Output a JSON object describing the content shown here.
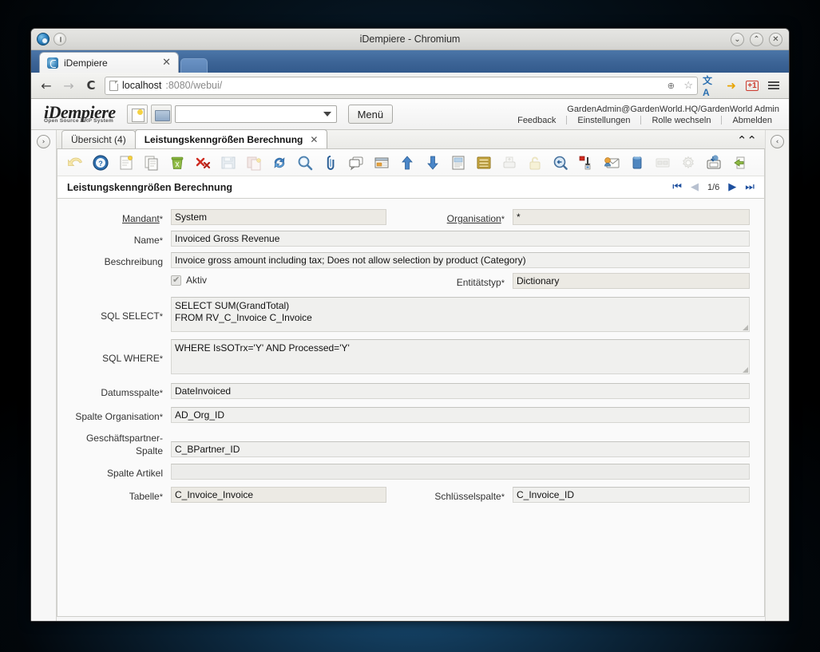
{
  "window": {
    "title": "iDempiere - Chromium",
    "minimize": "⌄",
    "maximize": "⌃",
    "close": "✕"
  },
  "browser": {
    "tab_title": "iDempiere",
    "tab_close": "✕",
    "back": "←",
    "forward": "→",
    "reload": "C",
    "url_host": "localhost",
    "url_rest": ":8080/webui/",
    "zoom_icon": "⊕",
    "bookmark_icon": "☆",
    "ext_translate": "文A",
    "ext_arrow": "➜",
    "ext_gplus": "+1"
  },
  "app_header": {
    "logo_main": "iDempiere",
    "logo_sub": "Open Source  ERP System",
    "new_button": "new-window-icon",
    "open_button": "open-folder-icon",
    "search_value": "",
    "menu_label": "Menü",
    "user": "GardenAdmin@GardenWorld.HQ/GardenWorld Admin",
    "links": [
      "Feedback",
      "Einstellungen",
      "Rolle wechseln",
      "Abmelden"
    ]
  },
  "sidebars": {
    "left_expand": "›",
    "right_collapse": "‹",
    "collapse_up": "⌃⌃"
  },
  "window_tabs": [
    {
      "label": "Übersicht (4)",
      "active": false,
      "closable": false
    },
    {
      "label": "Leistungskenngrößen Berechnung",
      "active": true,
      "closable": true,
      "close": "✕"
    }
  ],
  "toolbar": {
    "icons": [
      "undo-icon",
      "help-icon",
      "new-record-icon",
      "copy-record-icon",
      "delete-icon",
      "delete-selected-icon",
      "save-icon",
      "save-create-icon",
      "refresh-icon",
      "find-icon",
      "attachment-icon",
      "chat-icon",
      "grid-toggle-icon",
      "parent-record-icon",
      "detail-record-icon",
      "report-icon",
      "archive-icon",
      "print-icon",
      "lock-icon",
      "zoom-across-icon",
      "active-workflow-icon",
      "request-icon",
      "product-info-icon",
      "export-icon",
      "preference-icon",
      "archive-document-icon",
      "exit-icon"
    ]
  },
  "record": {
    "title": "Leistungskenngrößen Berechnung",
    "first": "⏮",
    "prev": "◀",
    "position": "1/6",
    "next": "▶",
    "last": "⏭"
  },
  "form": {
    "fields": {
      "mandant": {
        "label": "Mandant",
        "required": "*",
        "value": "System",
        "readonly": true,
        "underline": true
      },
      "organisation": {
        "label": "Organisation",
        "required": "*",
        "value": "*",
        "readonly": true,
        "underline": true
      },
      "name": {
        "label": "Name",
        "required": "*",
        "value": "Invoiced Gross Revenue"
      },
      "beschreibung": {
        "label": "Beschreibung",
        "required": "",
        "value": "Invoice gross amount including tax; Does not allow selection by product (Category)"
      },
      "aktiv": {
        "label": "Aktiv",
        "checked": true
      },
      "entitaetstyp": {
        "label": "Entitätstyp",
        "required": "*",
        "value": "Dictionary",
        "readonly": true
      },
      "sql_select": {
        "label": "SQL SELECT",
        "required": "*",
        "value": "SELECT SUM(GrandTotal)\nFROM RV_C_Invoice C_Invoice"
      },
      "sql_where": {
        "label": "SQL WHERE",
        "required": "*",
        "value": "WHERE IsSOTrx='Y' AND Processed='Y'"
      },
      "datumsspalte": {
        "label": "Datumsspalte",
        "required": "*",
        "value": "DateInvoiced"
      },
      "spalte_org": {
        "label": "Spalte Organisation",
        "required": "*",
        "value": "AD_Org_ID"
      },
      "gp_spalte": {
        "label": "Geschäftspartner-Spalte",
        "required": "",
        "value": "C_BPartner_ID"
      },
      "spalte_artikel": {
        "label": "Spalte Artikel",
        "required": "",
        "value": ""
      },
      "tabelle": {
        "label": "Tabelle",
        "required": "*",
        "value": "C_Invoice_Invoice",
        "readonly": true
      },
      "schluessel": {
        "label": "Schlüsselspalte",
        "required": "*",
        "value": "C_Invoice_ID"
      }
    }
  },
  "colors": {
    "accent_blue": "#1d4f9e",
    "tabstrip_blue": "#3c6496",
    "field_bg": "#f0f0ee",
    "readonly_bg": "#eceae4"
  }
}
